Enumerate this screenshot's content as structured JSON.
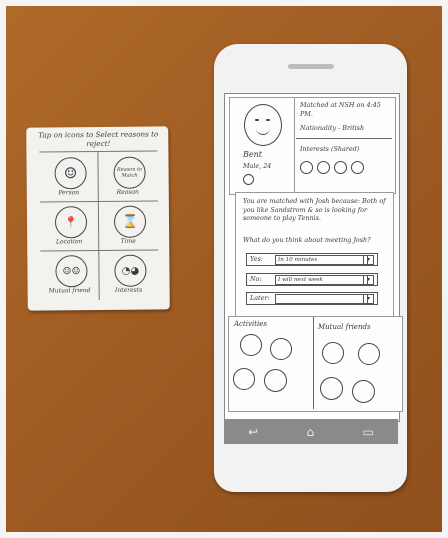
{
  "card": {
    "instruction": "Tap on icons to Select reasons to reject!",
    "options": [
      {
        "label": "Person",
        "icon_text": "☺",
        "icon": "face-icon"
      },
      {
        "label": "Reason",
        "icon_text": "Reason to Match",
        "icon": "reason-to-match-icon"
      },
      {
        "label": "Location",
        "icon_text": "📍",
        "icon": "location-pin-icon"
      },
      {
        "label": "Time",
        "icon_text": "⌛",
        "icon": "hourglass-icon"
      },
      {
        "label": "Mutual friend",
        "icon_text": "☺☺",
        "icon": "mutual-friend-icon"
      },
      {
        "label": "Interests",
        "icon_text": "◔◕",
        "icon": "interests-icon"
      }
    ]
  },
  "profile": {
    "name": "Bent",
    "details": "Male, 24",
    "matched_at": "Matched at NSH on 4:45 PM.",
    "nationality": "Nationality - British",
    "interests_label": "Interests (Shared)"
  },
  "match": {
    "message": "You are matched with Josh because: Both of you like Sandstrom & so is looking for someone to play Tennis.",
    "question": "What do you think about meeting Josh?"
  },
  "responses": [
    {
      "label": "Yes:",
      "value": "In 10 minutes"
    },
    {
      "label": "No:",
      "value": "I will next week"
    },
    {
      "label": "Later:",
      "value": ""
    }
  ],
  "sections": {
    "activities": "Activities",
    "mutual_friends": "Mutual friends"
  },
  "navbar": {
    "back": "↩",
    "home": "⌂",
    "recent": "▭"
  }
}
